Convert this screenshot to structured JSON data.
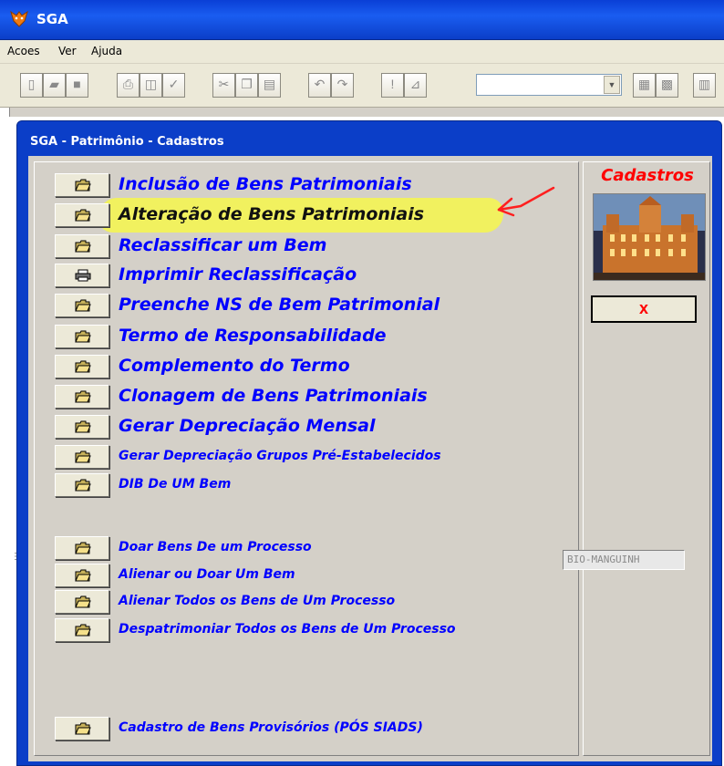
{
  "app": {
    "title": "SGA"
  },
  "menu": {
    "items": [
      "Acoes",
      "Ver",
      "Ajuda"
    ]
  },
  "toolbar": {
    "buttons": [
      "new-document",
      "open-folder",
      "save",
      "print",
      "print-preview",
      "spell-check",
      "cut",
      "copy",
      "paste",
      "undo",
      "redo",
      "exclamation",
      "chart",
      "tool-a",
      "tool-b",
      "tool-c"
    ],
    "combo_value": ""
  },
  "window": {
    "title": "SGA - Patrimônio - Cadastros"
  },
  "items": [
    {
      "label": "Inclusão de Bens Patrimoniais",
      "icon": "folder-icon"
    },
    {
      "label": "Alteração de Bens Patrimoniais",
      "icon": "folder-icon",
      "highlighted": true
    },
    {
      "label": "Reclassificar um Bem",
      "icon": "folder-icon"
    },
    {
      "label": "Imprimir Reclassificação",
      "icon": "printer-icon"
    },
    {
      "label": "Preenche NS de Bem Patrimonial",
      "icon": "folder-icon"
    },
    {
      "label": "Termo de Responsabilidade",
      "icon": "folder-icon"
    },
    {
      "label": "Complemento do Termo",
      "icon": "folder-icon"
    },
    {
      "label": "Clonagem de Bens Patrimoniais",
      "icon": "folder-icon"
    },
    {
      "label": "Gerar Depreciação Mensal",
      "icon": "folder-icon"
    },
    {
      "label": "Gerar Depreciação Grupos Pré-Estabelecidos",
      "icon": "folder-icon"
    },
    {
      "label": "DIB De UM Bem",
      "icon": "folder-icon"
    },
    {
      "label": "Doar Bens De um Processo",
      "icon": "folder-icon"
    },
    {
      "label": "Alienar ou Doar Um Bem",
      "icon": "folder-icon"
    },
    {
      "label": "Alienar Todos os Bens de Um Processo",
      "icon": "folder-icon"
    },
    {
      "label": "Despatrimoniar Todos os Bens de Um Processo",
      "icon": "folder-icon"
    },
    {
      "label": "Cadastro de Bens Provisórios (PÓS SIADS)",
      "icon": "folder-icon"
    }
  ],
  "side": {
    "title": "Cadastros",
    "close_icon": "x",
    "machine": "BIO-MANGUINH"
  },
  "colors": {
    "label_blue": "#0000ff",
    "title_red": "#ff0000",
    "highlight": "#f2f25a",
    "window_frame": "#0b3ec8"
  }
}
